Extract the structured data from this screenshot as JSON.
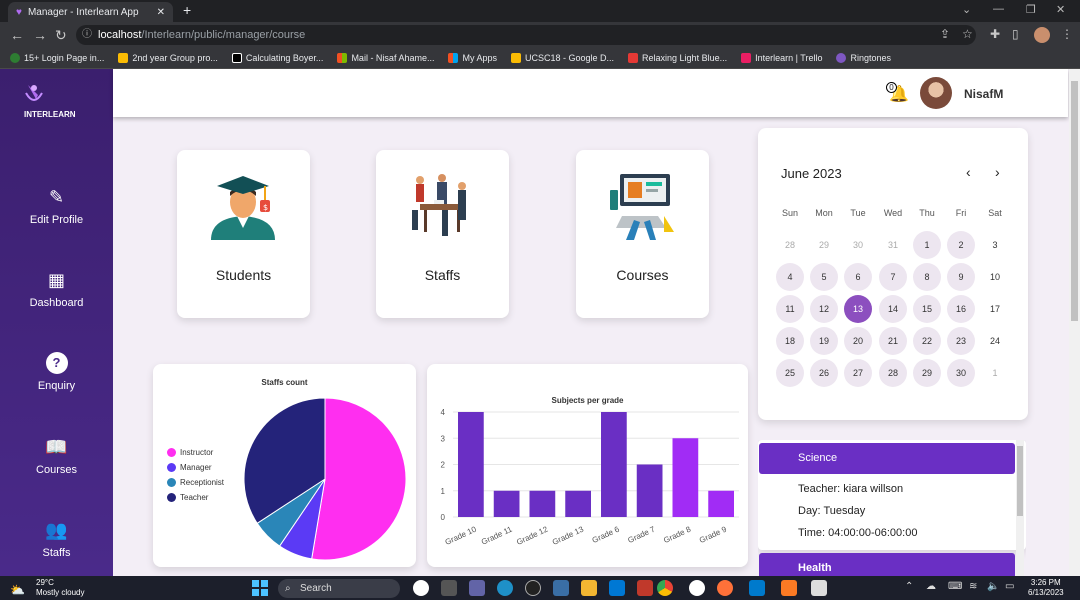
{
  "browser": {
    "tab_title": "Manager - Interlearn App",
    "url_host": "localhost",
    "url_path": "/Interlearn/public/manager/course",
    "bookmarks": [
      {
        "label": "15+ Login Page in...",
        "color": "#2e7d32"
      },
      {
        "label": "2nd year Group pro...",
        "color": "#fbbc04"
      },
      {
        "label": "Calculating Boyer...",
        "color": "#ffffff"
      },
      {
        "label": "Mail - Nisaf Ahame...",
        "color": "#f25022"
      },
      {
        "label": "My Apps",
        "color": "#f25022"
      },
      {
        "label": "UCSC18 - Google D...",
        "color": "#fbbc04"
      },
      {
        "label": "Relaxing Light Blue...",
        "color": "#e53935"
      },
      {
        "label": "Interlearn | Trello",
        "color": "#e91e63"
      },
      {
        "label": "Ringtones",
        "color": "#7e57c2"
      }
    ]
  },
  "app": {
    "logo_text": "INTERLEARN",
    "user_name": "NisafM",
    "notification_count": "0"
  },
  "sidebar": {
    "items": [
      {
        "label": "Edit Profile",
        "icon": "edit-icon"
      },
      {
        "label": "Dashboard",
        "icon": "grid-icon"
      },
      {
        "label": "Enquiry",
        "icon": "question-icon"
      },
      {
        "label": "Courses",
        "icon": "book-icon"
      },
      {
        "label": "Staffs",
        "icon": "people-icon"
      }
    ]
  },
  "cards": {
    "students": "Students",
    "staffs": "Staffs",
    "courses": "Courses"
  },
  "calendar": {
    "month": "June 2023",
    "weekdays": [
      "Sun",
      "Mon",
      "Tue",
      "Wed",
      "Thu",
      "Fri",
      "Sat"
    ],
    "weeks": [
      [
        "28",
        "29",
        "30",
        "31",
        "1",
        "2",
        "3"
      ],
      [
        "4",
        "5",
        "6",
        "7",
        "8",
        "9",
        "10"
      ],
      [
        "11",
        "12",
        "13",
        "14",
        "15",
        "16",
        "17"
      ],
      [
        "18",
        "19",
        "20",
        "21",
        "22",
        "23",
        "24"
      ],
      [
        "25",
        "26",
        "27",
        "28",
        "29",
        "30",
        "1"
      ]
    ],
    "selected": "13"
  },
  "chart_data": [
    {
      "type": "pie",
      "title": "Staffs count",
      "categories": [
        "Instructor",
        "Manager",
        "Receptionist",
        "Teacher"
      ],
      "values": [
        10,
        1.3,
        1.2,
        6.5
      ],
      "colors": [
        "#ff2ef0",
        "#5b3af5",
        "#2a86b8",
        "#24237a"
      ],
      "legend_position": "left"
    },
    {
      "type": "bar",
      "title": "Subjects per grade",
      "categories": [
        "Grade 10",
        "Grade 11",
        "Grade 12",
        "Grade 13",
        "Grade 6",
        "Grade 7",
        "Grade 8",
        "Grade 9"
      ],
      "values": [
        4,
        1,
        1,
        1,
        4,
        2,
        3,
        1
      ],
      "colors": [
        "#6a2fc4",
        "#6a2fc4",
        "#6a2fc4",
        "#6a2fc4",
        "#6a2fc4",
        "#6a2fc4",
        "#a12cf5",
        "#a12cf5"
      ],
      "yticks": [
        "0",
        "1",
        "2",
        "3",
        "4"
      ],
      "ylim": [
        0,
        4
      ],
      "grid": true
    }
  ],
  "subjects": [
    {
      "name": "Science",
      "teacher": "Teacher: kiara willson",
      "day": "Day: Tuesday",
      "time": "Time: 04:00:00-06:00:00"
    },
    {
      "name": "Health"
    }
  ],
  "taskbar": {
    "temp": "29°C",
    "weather": "Mostly cloudy",
    "search": "Search",
    "time": "3:26 PM",
    "date": "6/13/2023"
  }
}
